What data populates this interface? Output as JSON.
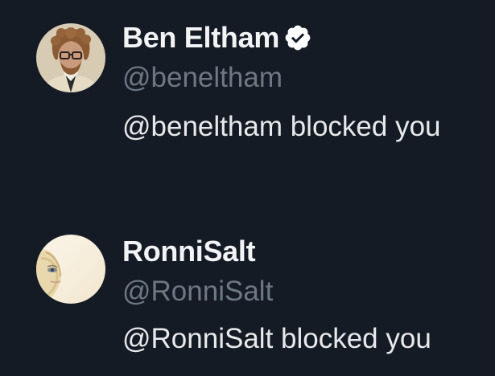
{
  "blocked_list": [
    {
      "display_name": "Ben Eltham",
      "verified": true,
      "handle": "@beneltham",
      "status": "@beneltham blocked you",
      "avatar_icon": "portrait-man-curly-hair-glasses"
    },
    {
      "display_name": "RonniSalt",
      "verified": false,
      "handle": "@RonniSalt",
      "status": "@RonniSalt blocked you",
      "avatar_icon": "portrait-woman-blonde-hair"
    }
  ],
  "colors": {
    "background": "#151b25",
    "name": "#f1f3f4",
    "handle": "#6e7882",
    "text": "#e7e9ea",
    "verified_badge": "#ffffff"
  }
}
